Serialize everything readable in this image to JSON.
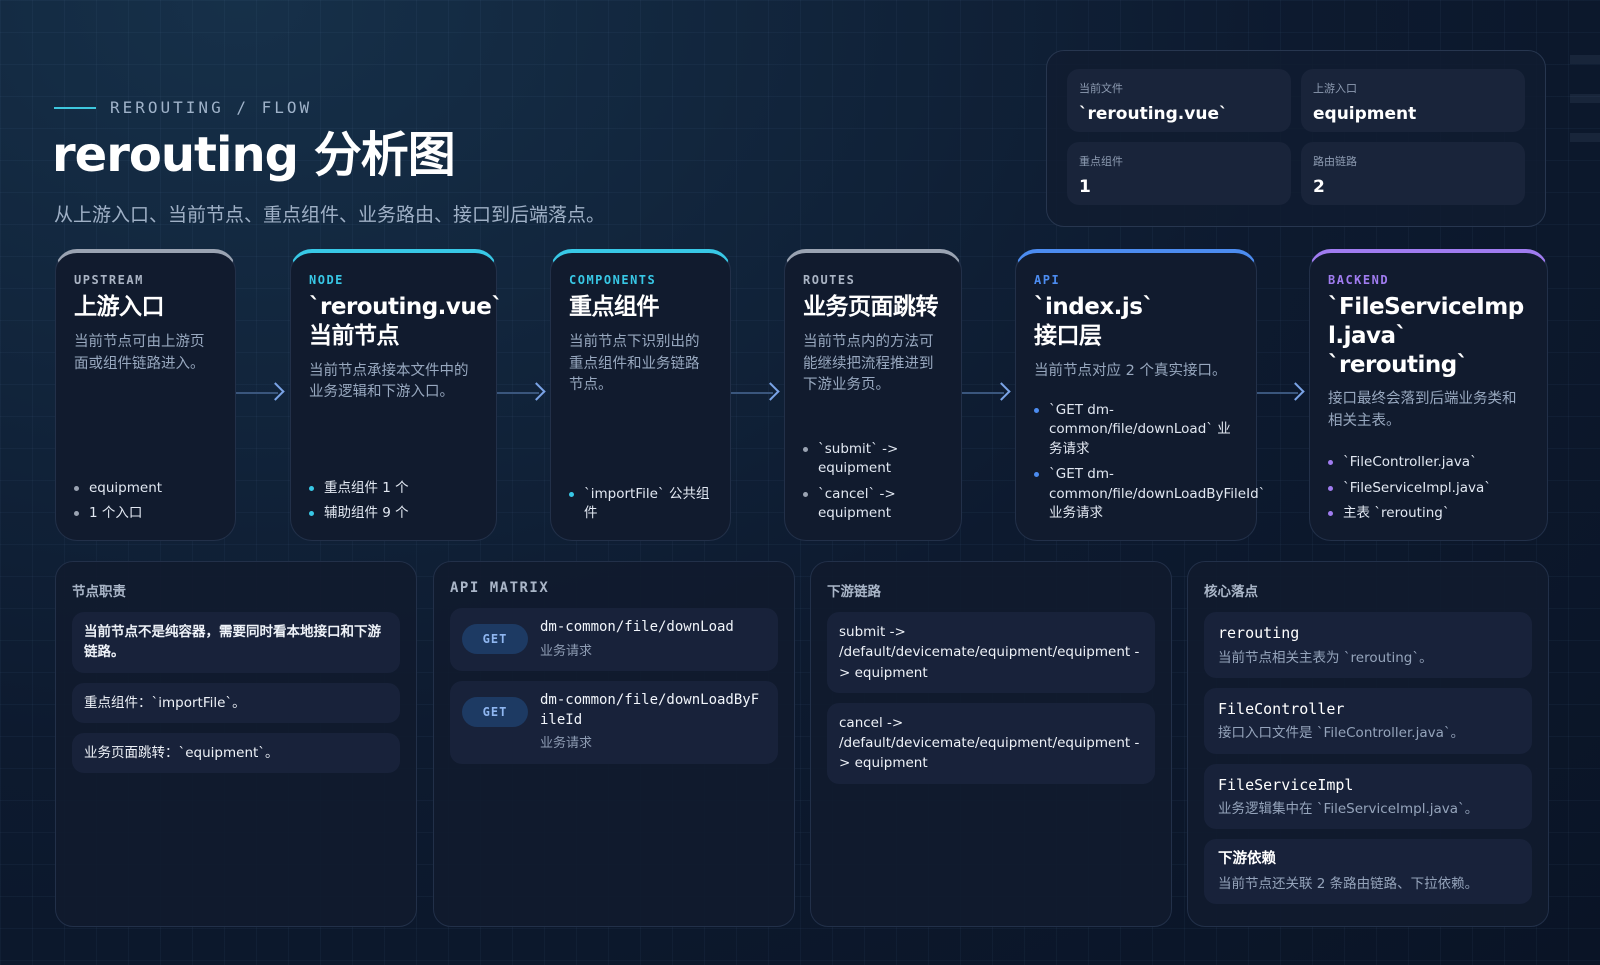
{
  "header": {
    "eyebrow": "REROUTING / FLOW",
    "title": "rerouting 分析图",
    "subtitle": "从上游入口、当前节点、重点组件、业务路由、接口到后端落点。"
  },
  "stats": [
    {
      "label": "当前文件",
      "value": "`rerouting.vue`"
    },
    {
      "label": "上游入口",
      "value": "equipment"
    },
    {
      "label": "重点组件",
      "value": "1"
    },
    {
      "label": "路由链路",
      "value": "2"
    }
  ],
  "colors": {
    "upstream": "#9aa3b2",
    "node": "#38c8e6",
    "components": "#38c8e6",
    "routes": "#9aa3b2",
    "api": "#4c8cf0",
    "backend": "#a07cf0"
  },
  "flow": {
    "upstream": {
      "tag": "UPSTREAM",
      "title": "上游入口",
      "desc": "当前节点可由上游页面或组件链路进入。",
      "items": [
        "equipment",
        "1 个入口"
      ]
    },
    "node": {
      "tag": "NODE",
      "title_line1": "`rerouting.vue`",
      "title_line2": "当前节点",
      "desc": "当前节点承接本文件中的业务逻辑和下游入口。",
      "items": [
        "重点组件 1 个",
        "辅助组件 9 个"
      ]
    },
    "components": {
      "tag": "COMPONENTS",
      "title": "重点组件",
      "desc": "当前节点下识别出的重点组件和业务链路节点。",
      "items": [
        "`importFile` 公共组件"
      ]
    },
    "routes": {
      "tag": "ROUTES",
      "title": "业务页面跳转",
      "desc": "当前节点内的方法可能继续把流程推进到下游业务页。",
      "items": [
        "`submit` -> equipment",
        "`cancel` -> equipment"
      ]
    },
    "api": {
      "tag": "API",
      "title_line1": "`index.js`",
      "title_line2": "接口层",
      "desc": "当前节点对应 2 个真实接口。",
      "items": [
        "`GET dm-common/file/downLoad` 业务请求",
        "`GET dm-common/file/downLoadByFileId` 业务请求"
      ]
    },
    "backend": {
      "tag": "BACKEND",
      "title_line1": "`FileServiceImpl.java`",
      "title_line2": "`rerouting`",
      "desc": "接口最终会落到后端业务类和相关主表。",
      "items": [
        "`FileController.java`",
        "`FileServiceImpl.java`",
        "主表 `rerouting`"
      ]
    }
  },
  "panels": {
    "duties": {
      "title": "节点职责",
      "items": [
        "当前节点不是纯容器，需要同时看本地接口和下游链路。",
        "重点组件：`importFile`。",
        "业务页面跳转：`equipment`。"
      ]
    },
    "api_matrix": {
      "title": "API MATRIX",
      "rows": [
        {
          "method": "GET",
          "path": "dm-common/file/downLoad",
          "type": "业务请求"
        },
        {
          "method": "GET",
          "path": "dm-common/file/downLoadByFileId",
          "type": "业务请求"
        }
      ]
    },
    "downstream": {
      "title": "下游链路",
      "items": [
        "submit -> /default/devicemate/equipment/equipment -> equipment",
        "cancel -> /default/devicemate/equipment/equipment -> equipment"
      ]
    },
    "core": {
      "title": "核心落点",
      "items": [
        {
          "name": "rerouting",
          "desc": "当前节点相关主表为 `rerouting`。"
        },
        {
          "name": "FileController",
          "desc": "接口入口文件是 `FileController.java`。"
        },
        {
          "name": "FileServiceImpl",
          "desc": "业务逻辑集中在 `FileServiceImpl.java`。"
        },
        {
          "name": "下游依赖",
          "desc": "当前节点还关联 2 条路由链路、下拉依赖。"
        }
      ]
    }
  }
}
